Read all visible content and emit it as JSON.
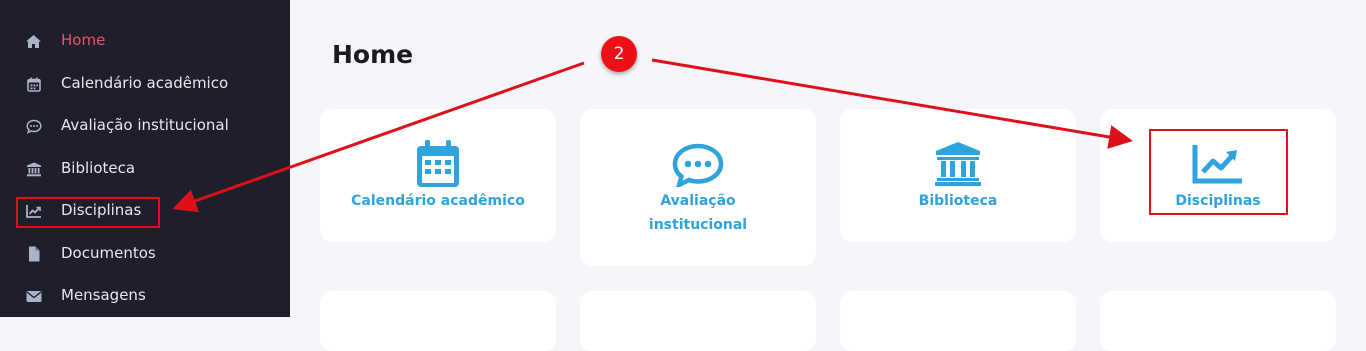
{
  "sidebar": {
    "items": [
      {
        "label": "Home",
        "icon": "home-icon",
        "active": true
      },
      {
        "label": "Calendário acadêmico",
        "icon": "calendar-icon"
      },
      {
        "label": "Avaliação institucional",
        "icon": "chat-icon"
      },
      {
        "label": "Biblioteca",
        "icon": "bank-icon"
      },
      {
        "label": "Disciplinas",
        "icon": "chart-line-icon"
      },
      {
        "label": "Documentos",
        "icon": "document-icon"
      },
      {
        "label": "Mensagens",
        "icon": "envelope-icon"
      }
    ]
  },
  "main": {
    "title": "Home",
    "cards": [
      {
        "label": "Calendário acadêmico",
        "icon": "calendar-icon"
      },
      {
        "label_line1": "Avaliação",
        "label_line2": "institucional",
        "icon": "chat-icon"
      },
      {
        "label": "Biblioteca",
        "icon": "bank-icon"
      },
      {
        "label": "Disciplinas",
        "icon": "chart-line-icon"
      }
    ]
  },
  "annotation": {
    "step_number": "2",
    "color": "#e0101a"
  },
  "colors": {
    "sidebar_bg": "#1f1f2b",
    "active_nav": "#f0506e",
    "accent": "#2ea3dd",
    "page_bg": "#f5f6fa"
  }
}
